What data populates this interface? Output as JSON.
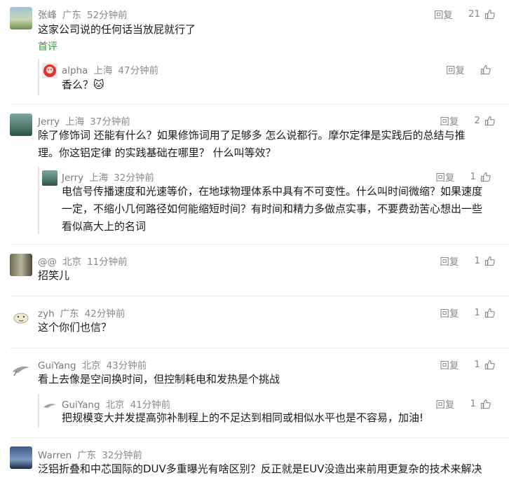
{
  "reply_label": "回复",
  "comments": [
    {
      "user": "张峰",
      "location": "广东",
      "time": "52分钟前",
      "likes": "21",
      "text": "这家公司说的任何话当放屁就行了",
      "tag": "首评",
      "replies": [
        {
          "user": "alpha",
          "location": "上海",
          "time": "47分钟前",
          "likes": "",
          "text": "香么？🐱"
        }
      ]
    },
    {
      "user": "Jerry",
      "location": "上海",
      "time": "37分钟前",
      "likes": "2",
      "text_lines": [
        "除了修饰词 还能有什么？如果修饰词用了足够多 怎么说都行。摩尔定律是实践后的总结与推",
        "理。你这铝定律 的实践基础在哪里？ 什么叫等效？"
      ],
      "replies": [
        {
          "user": "Jerry",
          "location": "上海",
          "time": "32分钟前",
          "likes": "1",
          "text_lines": [
            "电信号传播速度和光速等价，在地球物理体系中具有不可变性。什么叫时间微缩？如果速度",
            "一定，不缩小几何路径如何能缩短时间？有时间和精力多做点实事，不要费劲苦心想出一些",
            "看似高大上的名词"
          ]
        }
      ]
    },
    {
      "user": "@@",
      "location": "北京",
      "time": "11分钟前",
      "likes": "1",
      "text": "招笑儿",
      "replies": []
    },
    {
      "user": "zyh",
      "location": "广东",
      "time": "42分钟前",
      "likes": "1",
      "text": "这个你们也信？",
      "replies": []
    },
    {
      "user": "GuiYang",
      "location": "北京",
      "time": "43分钟前",
      "likes": "1",
      "text": "看上去像是空间换时间，但控制耗电和发热是个挑战",
      "replies": [
        {
          "user": "GuiYang",
          "location": "北京",
          "time": "41分钟前",
          "likes": "1",
          "text": "把规模变大并发提高弥补制程上的不足达到相同或相似水平也是不容易，加油!"
        }
      ]
    },
    {
      "user": "Warren",
      "location": "广东",
      "time": "32分钟前",
      "likes": "",
      "text": "泛铝折叠和中芯国际的DUV多重曝光有啥区别？反正就是EUV没造出来前用更复杂的技术来解决",
      "replies": []
    }
  ]
}
